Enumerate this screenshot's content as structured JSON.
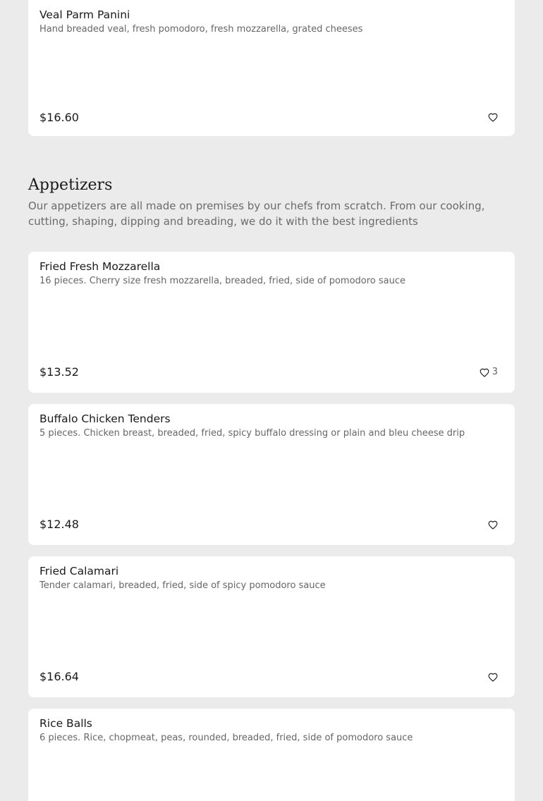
{
  "top_item": {
    "name": "Veal Parm Panini",
    "description": "Hand breaded veal, fresh pomodoro, fresh mozzarella, grated cheeses",
    "price": "$16.60",
    "favorite_icon": "heart-outline-icon"
  },
  "appetizers": {
    "title": "Appetizers",
    "description": "Our appetizers are all made on premises by our chefs from scratch. From our cooking, cutting, shaping, dipping and breading, we do it with the best ingredients",
    "items": [
      {
        "name": "Fried Fresh Mozzarella",
        "description": "16 pieces. Cherry size fresh mozzarella, breaded, fried, side of pomodoro sauce",
        "price": "$13.52",
        "favorite_count": "3"
      },
      {
        "name": "Buffalo Chicken Tenders",
        "description": "5 pieces. Chicken breast, breaded, fried, spicy buffalo dressing or plain and bleu cheese drip",
        "price": "$12.48"
      },
      {
        "name": "Fried Calamari",
        "description": "Tender calamari, breaded, fried, side of spicy pomodoro sauce",
        "price": "$16.64"
      },
      {
        "name": "Rice Balls",
        "description": "6 pieces. Rice, chopmeat, peas, rounded, breaded, fried, side of pomodoro sauce"
      }
    ]
  },
  "colors": {
    "page_background": "#ebebeb",
    "card_background": "#ffffff",
    "secondary_text": "#666666"
  }
}
